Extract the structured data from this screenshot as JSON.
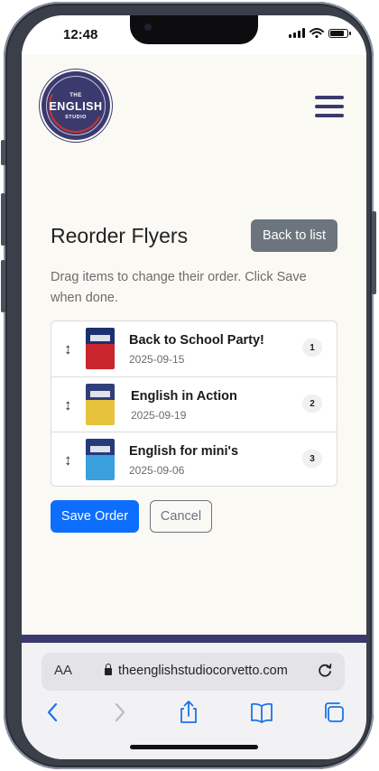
{
  "status_bar": {
    "time": "12:48"
  },
  "logo": {
    "line1": "THE",
    "line2": "ENGLISH",
    "line3": "STUDIO"
  },
  "header": {
    "menu_icon": "hamburger-menu-icon"
  },
  "main": {
    "title": "Reorder Flyers",
    "back_button": "Back to list",
    "hint": "Drag items to change their order. Click Save when done.",
    "flyers": [
      {
        "title": "Back to School Party!",
        "date": "2025-09-15",
        "position": "1"
      },
      {
        "title": "English in Action",
        "date": "2025-09-19",
        "position": "2"
      },
      {
        "title": "English for mini's",
        "date": "2025-09-06",
        "position": "3"
      }
    ],
    "save_button": "Save Order",
    "cancel_button": "Cancel"
  },
  "browser": {
    "text_size_label": "AA",
    "url": "theenglishstudiocorvetto.com"
  },
  "colors": {
    "brand": "#3b3a6e",
    "primary": "#0d6efd",
    "secondary": "#6c757d"
  }
}
